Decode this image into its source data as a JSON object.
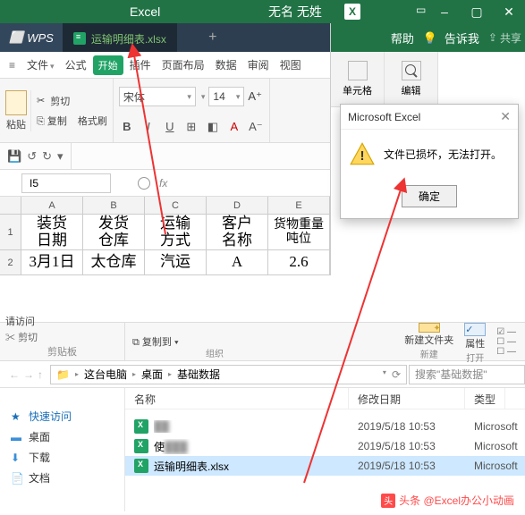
{
  "excel": {
    "app_name": "Excel",
    "doc_title": "无名 无姓",
    "help_label": "帮助",
    "tellme_label": "告诉我",
    "share_label": "共享",
    "cells_group": "单元格",
    "edit_group": "编辑",
    "dialog_title": "Microsoft Excel",
    "dialog_message": "文件已损坏，无法打开。",
    "dialog_ok": "确定"
  },
  "wps": {
    "logo": "WPS",
    "tab_filename": "运输明细表.xlsx",
    "menu": {
      "file": "文件",
      "formula": "公式",
      "start": "开始",
      "insert": "插件",
      "pagelayout": "页面布局",
      "data": "数据",
      "review": "审阅",
      "view": "视图"
    },
    "toolbar": {
      "paste": "粘贴",
      "cut": "剪切",
      "copy": "复制",
      "format_painter": "格式刷",
      "font_name": "宋体",
      "font_size": "14"
    },
    "namebox": "I5",
    "fx_label": "fx",
    "columns": [
      "A",
      "B",
      "C",
      "D",
      "E"
    ],
    "row1": [
      "装货日期",
      "发货仓库",
      "运输方式",
      "客户名称",
      "货物重量吨位"
    ],
    "row2": [
      "3月1日",
      "太仓库",
      "汽运",
      "A",
      "2.6"
    ]
  },
  "explorer": {
    "clipboard_group": "剪贴板",
    "org_group": "组织",
    "new_group": "新建",
    "open_group": "打开",
    "quick_access": "请访问",
    "cut_label": "剪切",
    "copyto_label": "复制到",
    "newfolder_label": "新建文件夹",
    "props_label": "属性",
    "nav": {
      "quick": "快速访问",
      "desktop": "桌面",
      "downloads": "下载",
      "documents": "文档"
    },
    "breadcrumb": [
      "这台电脑",
      "桌面",
      "基础数据"
    ],
    "search_placeholder": "搜索\"基础数据\"",
    "headers": {
      "name": "名称",
      "date": "修改日期",
      "type": "类型"
    },
    "files": [
      {
        "name": "██",
        "date": "2019/5/18 10:53",
        "type": "Microsoft"
      },
      {
        "name": "使███",
        "date": "2019/5/18 10:53",
        "type": "Microsoft"
      },
      {
        "name": "运输明细表.xlsx",
        "date": "2019/5/18 10:53",
        "type": "Microsoft"
      }
    ]
  },
  "watermark": "头条 @Excel办公小动画"
}
